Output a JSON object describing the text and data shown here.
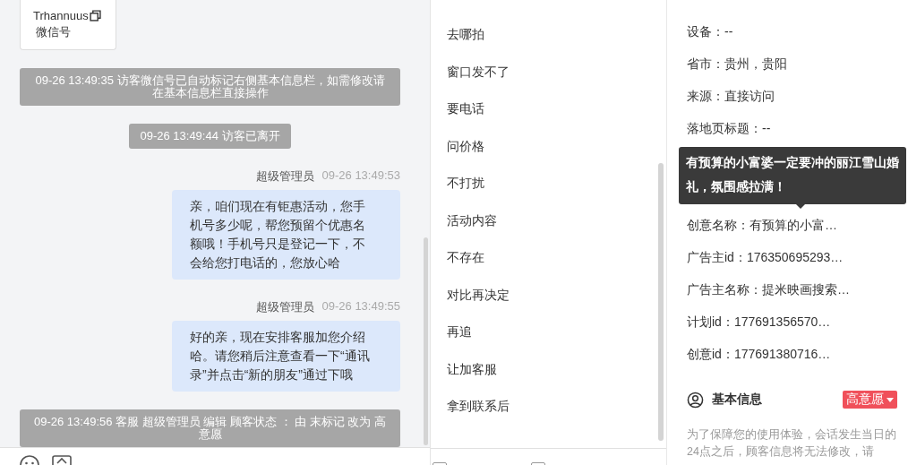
{
  "chat": {
    "contact_card": {
      "name": "Trhannuus",
      "label": "微信号"
    },
    "messages": [
      {
        "kind": "system",
        "text": "09-26 13:49:35 访客微信号已自动标记右侧基本信息栏，如需修改请在基本信息栏直接操作"
      },
      {
        "kind": "system",
        "text": "09-26 13:49:44 访客已离开"
      },
      {
        "kind": "agent",
        "sender": "超级管理员",
        "time": "09-26 13:49:53",
        "text": "亲，咱们现在有钜惠活动，您手机号多少呢，帮您预留个优惠名额哦！手机号只是登记一下，不会给您打电话的，您放心哈"
      },
      {
        "kind": "agent",
        "sender": "超级管理员",
        "time": "09-26 13:49:55",
        "text": "好的亲，现在安排客服加您介绍哈。请您稍后注意查看一下“通讯录”并点击“新的朋友”通过下哦"
      },
      {
        "kind": "system",
        "text": "09-26 13:49:56 客服 超级管理员 编辑 顾客状态 ： 由 末标记 改为 高意愿"
      }
    ]
  },
  "bottom_checkboxes": [
    {
      "checked": false
    },
    {
      "checked": false
    }
  ],
  "quick_replies": [
    "去哪拍",
    "窗口发不了",
    "要电话",
    "问价格",
    "不打扰",
    "活动内容",
    "不存在",
    "对比再决定",
    "再追",
    "让加客服",
    "拿到联系后"
  ],
  "visitor_info": {
    "rows_before_tooltip": [
      "设备：--",
      "省市：贵州，贵阳",
      "来源：直接访问",
      "落地页标题：--"
    ],
    "tooltip": "有预算的小富婆一定要冲的丽江雪山婚礼，氛围感拉满！",
    "rows_after_tooltip": [
      "创意名称：有预算的小富…",
      "广告主id：176350695293…",
      "广告主名称：提米映画搜索…",
      "计划id：177691356570…",
      "创意id：177691380716…"
    ]
  },
  "basic_info": {
    "title": "基本信息",
    "status_tag": "高意愿",
    "note": "为了保障您的使用体验，会话发生当日的24点之后，顾客信息将无法修改，请"
  }
}
